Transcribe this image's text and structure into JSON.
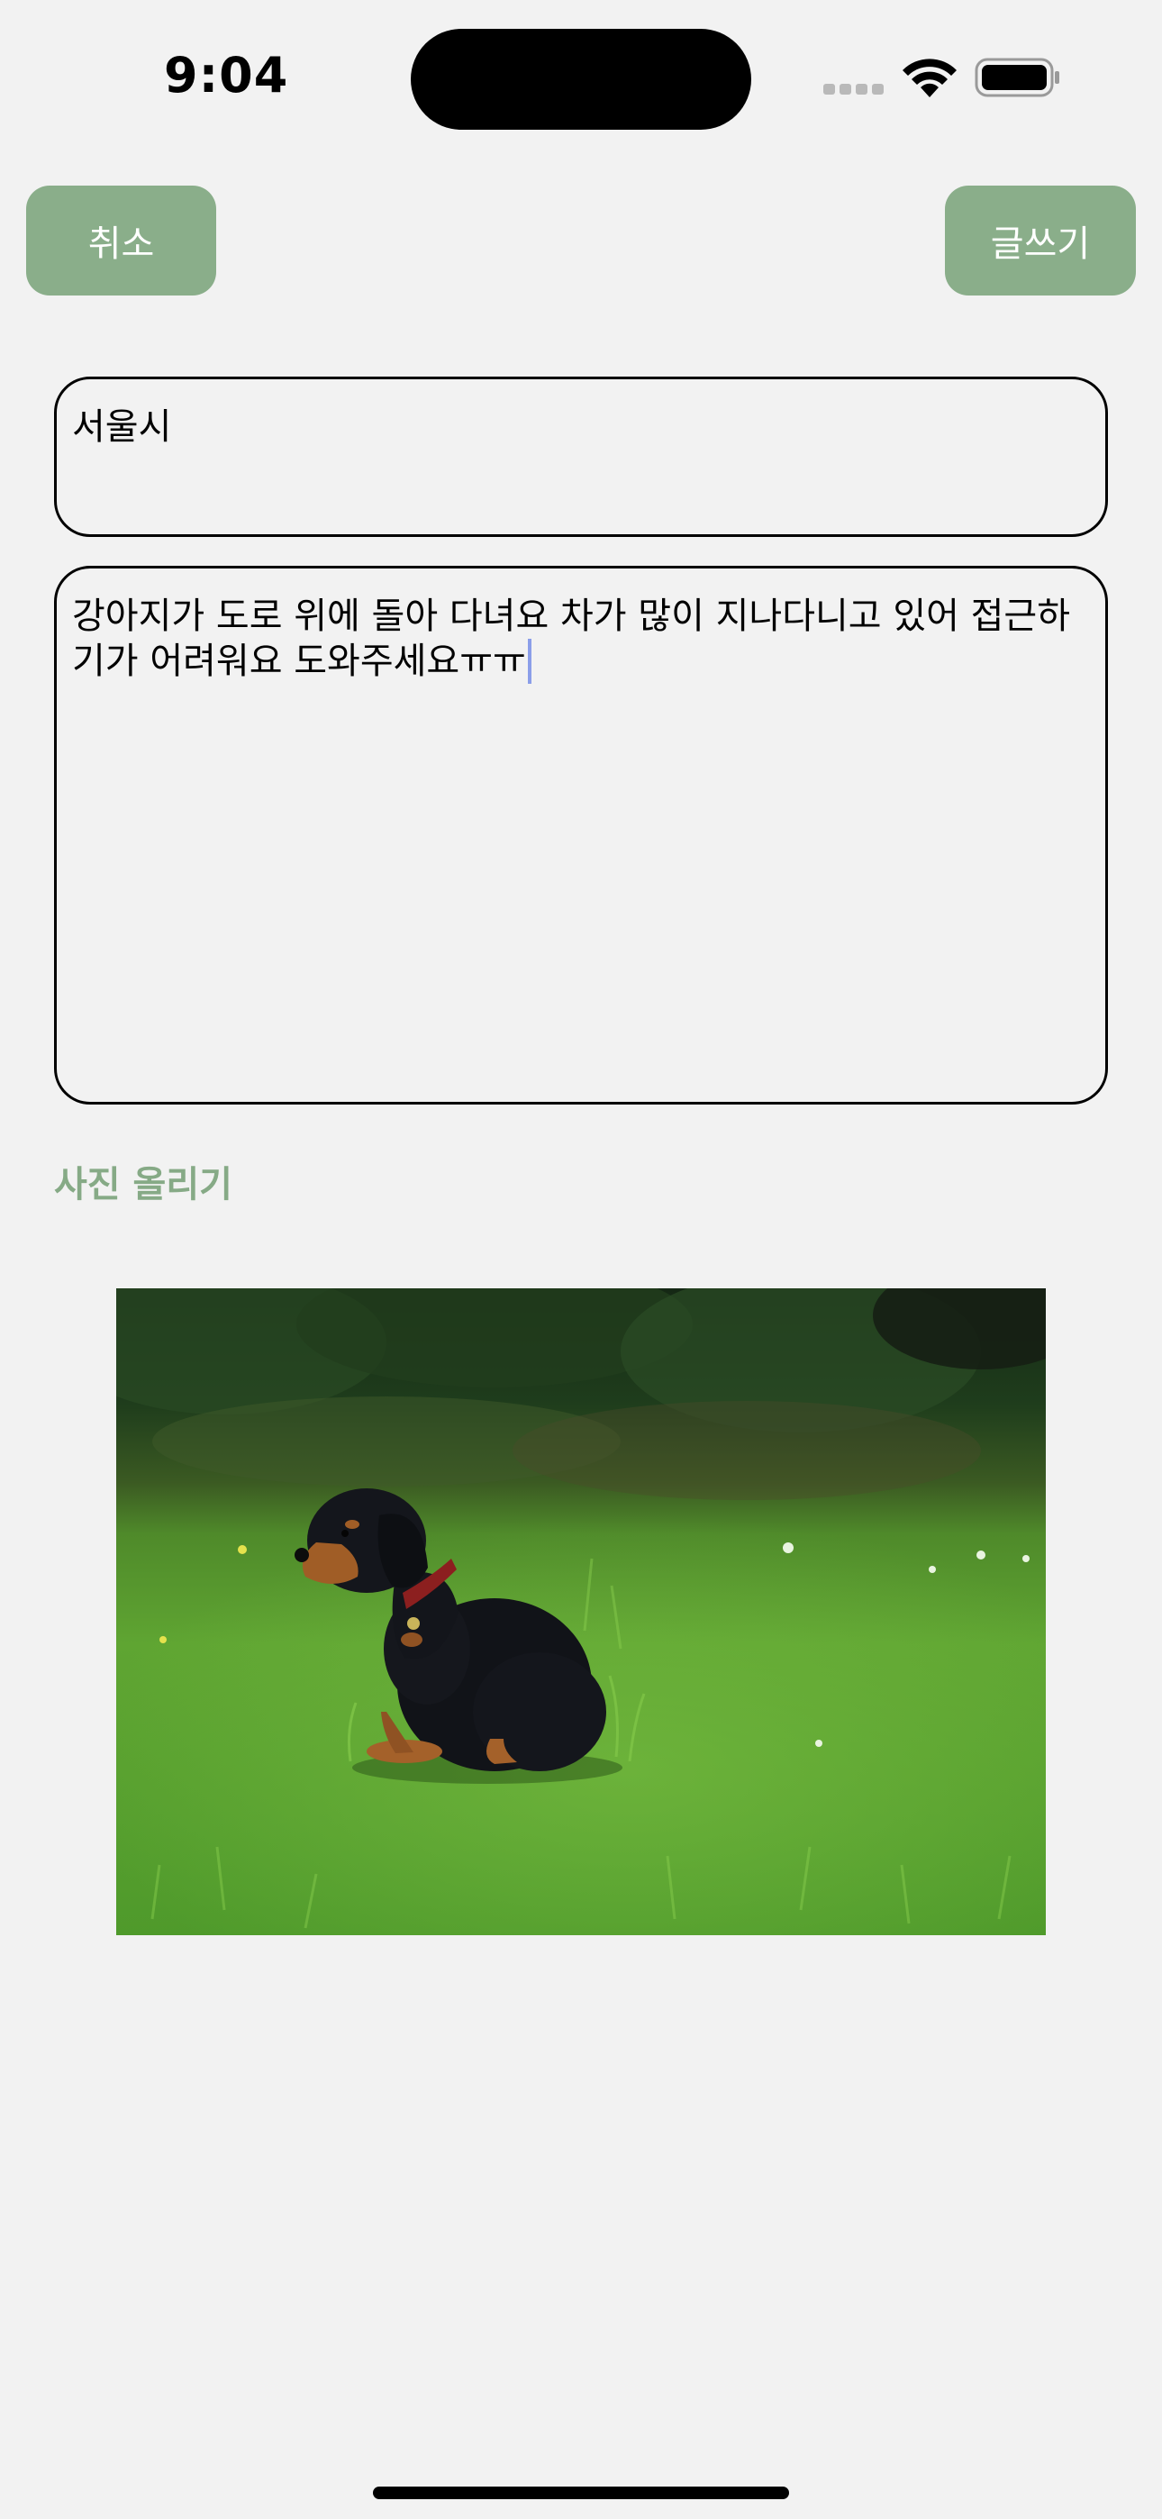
{
  "status_bar": {
    "time": "9:04"
  },
  "toolbar": {
    "cancel_label": "취소",
    "write_label": "글쓰기"
  },
  "form": {
    "title_value": "서울시",
    "body_value": "강아지가 도로 위에 돌아 다녀요 차가 많이 지나다니고 있어 접근하기가 어려워요 도와주세요ㅠㅠ",
    "upload_label": "사진 올리기"
  },
  "photo": {
    "icon": "dog-photo"
  },
  "colors": {
    "accent": "#8aae8a",
    "upload_text": "#86aa86",
    "background": "#f2f2f2",
    "caret": "#8b9ee9"
  }
}
